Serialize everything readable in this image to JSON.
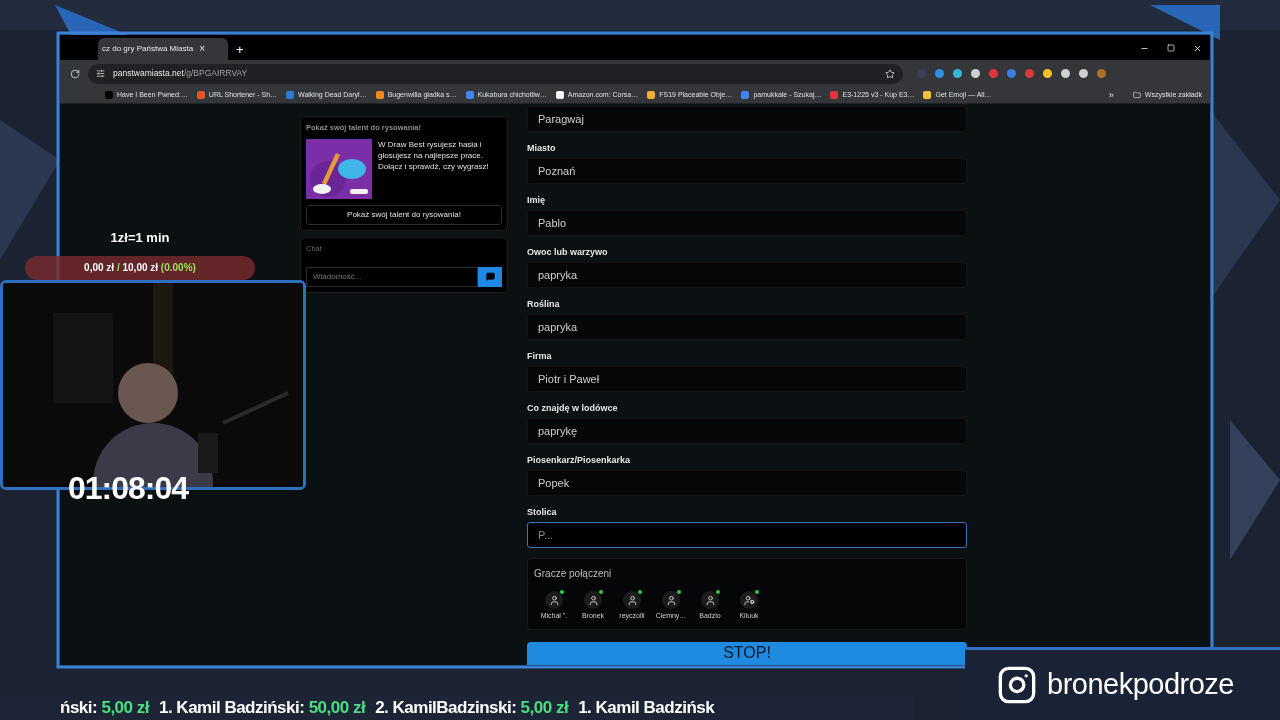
{
  "browser": {
    "tab": {
      "title": "cz do gry Państwa Miasta",
      "close": "×"
    },
    "new_tab": "+",
    "url": {
      "host": "panstwamiasta.net",
      "path": "/g/BPGAIRRVAY"
    },
    "extensions": [
      {
        "color": "#3a3f5a"
      },
      {
        "color": "#2f8fe0"
      },
      {
        "color": "#37b6d6"
      },
      {
        "color": "#cfcfcf"
      },
      {
        "color": "#e0343c"
      },
      {
        "color": "#3b7de0"
      },
      {
        "color": "#d83a3a"
      },
      {
        "color": "#f2c230"
      },
      {
        "color": "#d0d0d0"
      },
      {
        "color": "#cfcfcf"
      },
      {
        "color": "#b0702a"
      }
    ],
    "bookmarks": [
      {
        "label": "Have I Been Pwned:…",
        "color": "#000000"
      },
      {
        "label": "URL Shortener - Sh…",
        "color": "#e0552a"
      },
      {
        "label": "Walking Dead Daryl…",
        "color": "#2d7ad6"
      },
      {
        "label": "Bugenwilla gładka s…",
        "color": "#f08a1c"
      },
      {
        "label": "Kukabura chichotliw…",
        "color": "#4285f4"
      },
      {
        "label": "Amazon.com: Corsa…",
        "color": "#f5f5f5"
      },
      {
        "label": "FS19 Placeable Obje…",
        "color": "#f0b030"
      },
      {
        "label": "pamukkale - Szukaj…",
        "color": "#4285f4"
      },
      {
        "label": "E3-1225 v3 - Kup E3…",
        "color": "#e0343c"
      },
      {
        "label": "Get Emoji — All…",
        "color": "#f2c230"
      }
    ],
    "more_bookmarks": "»",
    "all_bookmarks": "Wszystkie zakładk"
  },
  "promo": {
    "title": "Pokaż swój talent do rysowania!",
    "text": "W Draw Best rysujesz hasła i głosujesz na najlepsze prace. Dołącz i sprawdź, czy wygrasz!",
    "button": "Pokaż swój talent do rysowania!"
  },
  "chat": {
    "title": "Chat",
    "placeholder": "Wiadomość..."
  },
  "form": {
    "fields": [
      {
        "value": "Paragwaj",
        "focused": false
      },
      {
        "label": "Miasto",
        "value": "Poznań",
        "focused": false
      },
      {
        "label": "Imię",
        "value": "Pablo",
        "focused": false
      },
      {
        "label": "Owoc lub warzywo",
        "value": "papryka",
        "focused": false
      },
      {
        "label": "Roślina",
        "value": "papryka",
        "focused": false
      },
      {
        "label": "Firma",
        "value": "Piotr i Paweł",
        "focused": false
      },
      {
        "label": "Co znajdę w lodówce",
        "value": "paprykę",
        "focused": false
      },
      {
        "label": "Piosenkarz/Piosenkarka",
        "value": "Popek",
        "focused": false
      },
      {
        "label": "Stolica",
        "value": "P...",
        "focused": true
      }
    ],
    "players_title": "Gracze połączeni",
    "players": [
      {
        "name": "Michał \".",
        "kind": "user",
        "online": true
      },
      {
        "name": "Bronek",
        "kind": "user",
        "online": true
      },
      {
        "name": "reyczolli",
        "kind": "user",
        "online": true
      },
      {
        "name": "Ciemny…",
        "kind": "user",
        "online": true
      },
      {
        "name": "Badzio",
        "kind": "user",
        "online": true
      },
      {
        "name": "Kiluuk",
        "kind": "host",
        "online": true
      }
    ],
    "stop_button": "STOP!"
  },
  "overlay": {
    "rate": "1zł=1 min",
    "goal": {
      "current": "0,00 zł",
      "separator": "/",
      "target": "10,00 zł",
      "percent": "(0.00%)",
      "level": 0
    },
    "timer": "01:08:04",
    "ticker": [
      {
        "name": "ński:",
        "amount": "5,00 zł"
      },
      {
        "name": "1. Kamil Badziński:",
        "amount": "50,00 zł"
      },
      {
        "name": "2. KamilBadzinski:",
        "amount": "5,00 zł"
      },
      {
        "name": "1. Kamil Badzińsk"
      }
    ],
    "instagram": "bronekpodroze"
  }
}
